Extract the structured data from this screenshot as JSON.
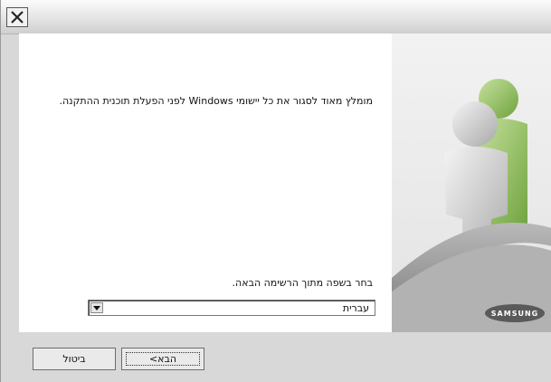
{
  "titlebar": {
    "close_icon": "close-icon"
  },
  "main": {
    "message": "מומלץ מאוד לסגור את כל יישומי Windows לפני הפעלת תוכנית ההתקנה.",
    "language_label": "בחר בשפה מתוך הרשימה הבאה.",
    "language_value": "עברית"
  },
  "side": {
    "logo_text": "SAMSUNG"
  },
  "buttons": {
    "next_label": "הבא>",
    "cancel_label": "ביטול"
  },
  "colors": {
    "accent_green": "#9bc76a",
    "person_gray": "#c9c9c9"
  }
}
